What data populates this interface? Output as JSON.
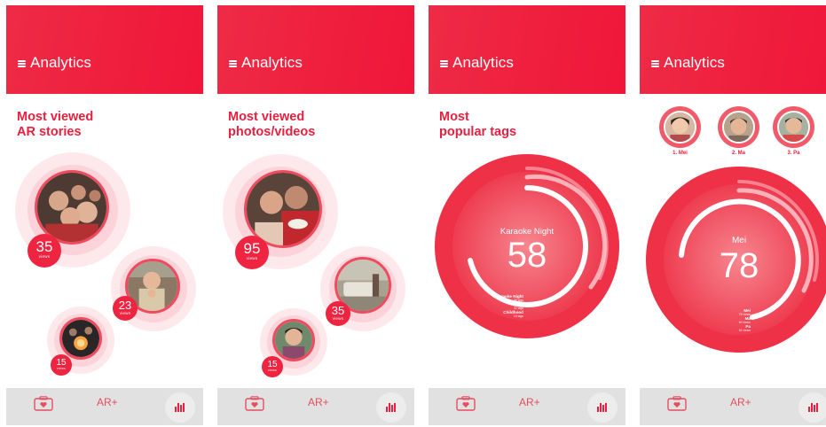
{
  "app": {
    "title": "Analytics",
    "colors": {
      "brand_red": "#ee1f3d",
      "tab_bar": "#e1e1e1",
      "halo": "#fbd3d9"
    }
  },
  "screens": [
    {
      "section_title_line1": "Most viewed",
      "section_title_line2": "AR stories",
      "bubbles": [
        {
          "views": "35",
          "views_label": "views"
        },
        {
          "views": "23",
          "views_label": "views"
        },
        {
          "views": "15",
          "views_label": "views"
        }
      ]
    },
    {
      "section_title_line1": "Most viewed",
      "section_title_line2": "photos/videos",
      "bubbles": [
        {
          "views": "95",
          "views_label": "views"
        },
        {
          "views": "35",
          "views_label": "views"
        },
        {
          "views": "15",
          "views_label": "views"
        }
      ]
    },
    {
      "section_title_line1": "Most",
      "section_title_line2": "popular tags",
      "donut": {
        "label": "Karaoke Night",
        "value": "58",
        "legend": [
          {
            "name": "Karaoke Night",
            "count": "58 tags"
          },
          {
            "name": "CNY",
            "count": "32 tags"
          },
          {
            "name": "Childhood",
            "count": "18 tags"
          }
        ]
      }
    },
    {
      "avatars": [
        {
          "label": "1. Mei"
        },
        {
          "label": "2. Ma"
        },
        {
          "label": "3. Pa"
        }
      ],
      "donut": {
        "label": "Mei",
        "value": "78",
        "legend": [
          {
            "name": "Mei",
            "count": "78 views"
          },
          {
            "name": "Ma",
            "count": "60 views"
          },
          {
            "name": "Pa",
            "count": "52 views"
          }
        ]
      }
    }
  ],
  "tabs": {
    "camera_icon": "camera-heart-icon",
    "ar_label": "AR+",
    "analytics_icon": "bar-chart-icon"
  }
}
